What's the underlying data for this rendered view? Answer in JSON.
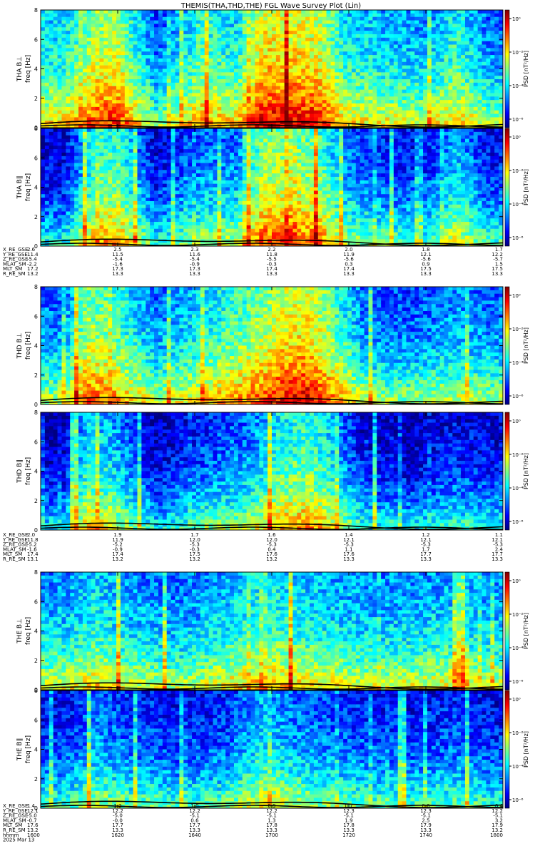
{
  "chart_data": {
    "type": "heatmap",
    "title": "THEMIS(THA,THD,THE) FGL Wave Survey Plot (Lin)",
    "freq_label": "freq [Hz]",
    "colorbar_label": "PSD [nT²/Hz]",
    "colorbar_ticks": [
      "10⁰",
      "10⁻²",
      "10⁻⁴",
      "10⁻⁶"
    ],
    "y_ticks": [
      "0",
      "2",
      "4",
      "6",
      "8"
    ],
    "ylim": [
      0,
      8
    ],
    "colormap": [
      "#000080",
      "#0000ff",
      "#0080ff",
      "#00ffff",
      "#80ff80",
      "#ffff00",
      "#ff8000",
      "#ff0000",
      "#800000"
    ],
    "groups": [
      {
        "panels": [
          {
            "label": "THA B⊥",
            "intensity": [
              [
                0.05,
                0.6
              ],
              [
                0.12,
                0.85
              ],
              [
                0.17,
                0.85
              ],
              [
                0.25,
                0.4
              ],
              [
                0.35,
                0.7
              ],
              [
                0.42,
                0.6
              ],
              [
                0.48,
                0.95
              ],
              [
                0.55,
                0.95
              ],
              [
                0.6,
                0.9
              ],
              [
                0.66,
                0.6
              ],
              [
                0.75,
                0.55
              ],
              [
                0.83,
                0.5
              ],
              [
                0.9,
                0.65
              ],
              [
                0.97,
                0.45
              ]
            ]
          },
          {
            "label": "THA B∥",
            "intensity": [
              [
                0.05,
                0.25
              ],
              [
                0.12,
                0.7
              ],
              [
                0.17,
                0.7
              ],
              [
                0.25,
                0.25
              ],
              [
                0.35,
                0.45
              ],
              [
                0.42,
                0.45
              ],
              [
                0.48,
                0.8
              ],
              [
                0.55,
                0.8
              ],
              [
                0.6,
                0.75
              ],
              [
                0.66,
                0.45
              ],
              [
                0.75,
                0.35
              ],
              [
                0.83,
                0.3
              ],
              [
                0.9,
                0.55
              ],
              [
                0.97,
                0.3
              ]
            ]
          }
        ],
        "ephemeris": {
          "labels": [
            "X_RE_GSE",
            "Y_RE_GSE",
            "Z_RE_GSE",
            "MLAT_SM",
            "MLT_SM",
            "R_RE_SM"
          ],
          "rows": [
            [
              "2.6",
              "2.5",
              "2.3",
              "2.2",
              "2.0",
              "1.8",
              "1.7"
            ],
            [
              "11.4",
              "11.5",
              "11.6",
              "11.8",
              "11.9",
              "12.1",
              "12.2"
            ],
            [
              "-5.4",
              "-5.4",
              "-5.4",
              "-5.5",
              "-5.6",
              "-5.6",
              "-5.7"
            ],
            [
              "-2.2",
              "-1.6",
              "-0.9",
              "-0.3",
              "0.3",
              "0.9",
              "1.5"
            ],
            [
              "17.2",
              "17.3",
              "17.3",
              "17.4",
              "17.4",
              "17.5",
              "17.5"
            ],
            [
              "13.2",
              "13.3",
              "13.3",
              "13.3",
              "13.3",
              "13.3",
              "13.3"
            ]
          ]
        }
      },
      {
        "panels": [
          {
            "label": "THD B⊥",
            "intensity": [
              [
                0.05,
                0.45
              ],
              [
                0.1,
                0.8
              ],
              [
                0.15,
                0.75
              ],
              [
                0.25,
                0.45
              ],
              [
                0.35,
                0.6
              ],
              [
                0.45,
                0.75
              ],
              [
                0.52,
                0.9
              ],
              [
                0.58,
                0.95
              ],
              [
                0.62,
                0.8
              ],
              [
                0.7,
                0.45
              ],
              [
                0.8,
                0.4
              ],
              [
                0.9,
                0.5
              ],
              [
                0.97,
                0.45
              ]
            ]
          },
          {
            "label": "THD B∥",
            "intensity": [
              [
                0.05,
                0.2
              ],
              [
                0.1,
                0.6
              ],
              [
                0.15,
                0.55
              ],
              [
                0.25,
                0.2
              ],
              [
                0.35,
                0.35
              ],
              [
                0.45,
                0.45
              ],
              [
                0.52,
                0.65
              ],
              [
                0.58,
                0.7
              ],
              [
                0.62,
                0.6
              ],
              [
                0.7,
                0.25
              ],
              [
                0.8,
                0.2
              ],
              [
                0.9,
                0.3
              ],
              [
                0.97,
                0.25
              ]
            ]
          }
        ],
        "ephemeris": {
          "labels": [
            "X_RE_GSE",
            "Y_RE_GSE",
            "Z_RE_GSE",
            "MLAT_SM",
            "MLT_SM",
            "R_RE_SM"
          ],
          "rows": [
            [
              "2.0",
              "1.9",
              "1.7",
              "1.6",
              "1.4",
              "1.2",
              "1.1"
            ],
            [
              "11.8",
              "11.9",
              "12.0",
              "12.0",
              "12.1",
              "12.1",
              "12.1"
            ],
            [
              "-5.2",
              "-5.2",
              "-5.3",
              "-5.3",
              "-5.3",
              "-5.3",
              "-5.3"
            ],
            [
              "-1.6",
              "-0.9",
              "-0.3",
              "0.4",
              "1.1",
              "1.7",
              "2.4"
            ],
            [
              "17.4",
              "17.4",
              "17.5",
              "17.6",
              "17.6",
              "17.7",
              "17.7"
            ],
            [
              "13.1",
              "13.2",
              "13.2",
              "13.2",
              "13.3",
              "13.3",
              "13.3"
            ]
          ]
        }
      },
      {
        "panels": [
          {
            "label": "THE B⊥",
            "intensity": [
              [
                0.05,
                0.5
              ],
              [
                0.12,
                0.6
              ],
              [
                0.2,
                0.5
              ],
              [
                0.3,
                0.45
              ],
              [
                0.4,
                0.55
              ],
              [
                0.48,
                0.65
              ],
              [
                0.55,
                0.6
              ],
              [
                0.62,
                0.55
              ],
              [
                0.7,
                0.5
              ],
              [
                0.8,
                0.5
              ],
              [
                0.9,
                0.55
              ],
              [
                0.97,
                0.5
              ]
            ]
          },
          {
            "label": "THE B∥",
            "intensity": [
              [
                0.05,
                0.3
              ],
              [
                0.12,
                0.45
              ],
              [
                0.2,
                0.35
              ],
              [
                0.3,
                0.3
              ],
              [
                0.4,
                0.35
              ],
              [
                0.48,
                0.55
              ],
              [
                0.55,
                0.45
              ],
              [
                0.62,
                0.4
              ],
              [
                0.7,
                0.35
              ],
              [
                0.8,
                0.3
              ],
              [
                0.9,
                0.35
              ],
              [
                0.97,
                0.3
              ]
            ]
          }
        ],
        "ephemeris": {
          "labels": [
            "X_RE_GSE",
            "Y_RE_GSE",
            "Z_RE_GSE",
            "MLAT_SM",
            "MLT_SM",
            "R_RE_SM",
            "hhmm"
          ],
          "rows": [
            [
              "1.4",
              "1.2",
              "1.0",
              "0.9",
              "0.7",
              "0.6",
              "0.4"
            ],
            [
              "12.1",
              "12.2",
              "12.2",
              "12.2",
              "12.3",
              "12.3",
              "12.2"
            ],
            [
              "-5.0",
              "-5.0",
              "-5.1",
              "-5.1",
              "-5.1",
              "-5.1",
              "-5.1"
            ],
            [
              "-0.7",
              "-0.0",
              "0.6",
              "1.3",
              "1.9",
              "2.5",
              "3.2"
            ],
            [
              "17.6",
              "17.7",
              "17.7",
              "17.8",
              "17.8",
              "17.9",
              "17.9"
            ],
            [
              "13.2",
              "13.3",
              "13.3",
              "13.3",
              "13.3",
              "13.3",
              "13.2"
            ],
            [
              "1600",
              "1620",
              "1640",
              "1700",
              "1720",
              "1740",
              "1800"
            ]
          ],
          "date": "2025 Mar 13"
        }
      }
    ],
    "overlay_lines": "black",
    "grid": false,
    "legend": "colorbar-right"
  }
}
